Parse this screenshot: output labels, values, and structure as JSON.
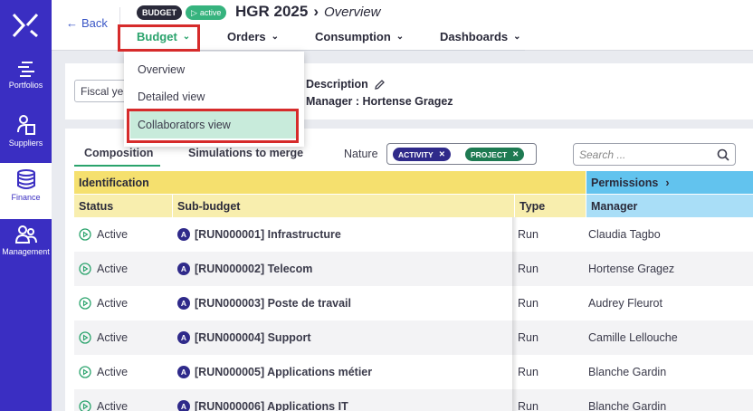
{
  "header": {
    "back_label": "Back",
    "badge_type": "BUDGET",
    "badge_status": "active",
    "title": "HGR 2025",
    "subtitle": "Overview",
    "tabs": [
      {
        "label": "Budget"
      },
      {
        "label": "Orders"
      },
      {
        "label": "Consumption"
      },
      {
        "label": "Dashboards"
      }
    ]
  },
  "sidebar": {
    "items": [
      {
        "label": "Portfolios"
      },
      {
        "label": "Suppliers"
      },
      {
        "label": "Finance"
      },
      {
        "label": "Management"
      }
    ]
  },
  "dropdown": {
    "items": [
      {
        "label": "Overview"
      },
      {
        "label": "Detailed view"
      },
      {
        "label": "Collaborators view"
      }
    ]
  },
  "filters": {
    "fiscal_label": "Fiscal year",
    "description_label": "Description",
    "manager_line": "Manager : Hortense Gragez"
  },
  "table_panel": {
    "tabs": [
      "Composition",
      "Simulations to merge"
    ],
    "nature_label": "Nature",
    "chips": [
      "ACTIVITY",
      "PROJECT"
    ],
    "search_placeholder": "Search ...",
    "groups": {
      "identification": "Identification",
      "permissions": "Permissions"
    },
    "columns": {
      "status": "Status",
      "sub_budget": "Sub-budget",
      "type": "Type",
      "manager": "Manager"
    },
    "rows": [
      {
        "status": "Active",
        "badge": "A",
        "sub_budget": "[RUN000001] Infrastructure",
        "type": "Run",
        "manager": "Claudia Tagbo"
      },
      {
        "status": "Active",
        "badge": "A",
        "sub_budget": "[RUN000002] Telecom",
        "type": "Run",
        "manager": "Hortense Gragez"
      },
      {
        "status": "Active",
        "badge": "A",
        "sub_budget": "[RUN000003] Poste de travail",
        "type": "Run",
        "manager": "Audrey Fleurot"
      },
      {
        "status": "Active",
        "badge": "A",
        "sub_budget": "[RUN000004] Support",
        "type": "Run",
        "manager": "Camille Lellouche"
      },
      {
        "status": "Active",
        "badge": "A",
        "sub_budget": "[RUN000005] Applications métier",
        "type": "Run",
        "manager": "Blanche Gardin"
      },
      {
        "status": "Active",
        "badge": "A",
        "sub_budget": "[RUN000006] Applications IT",
        "type": "Run",
        "manager": "Blanche Gardin"
      }
    ]
  },
  "colors": {
    "sidebar": "#3a2ec2",
    "accent_green": "#2aa36c",
    "highlight_red": "#d62b2b",
    "identification_yellow": "#f5e06e",
    "permissions_blue": "#62c3ee"
  }
}
